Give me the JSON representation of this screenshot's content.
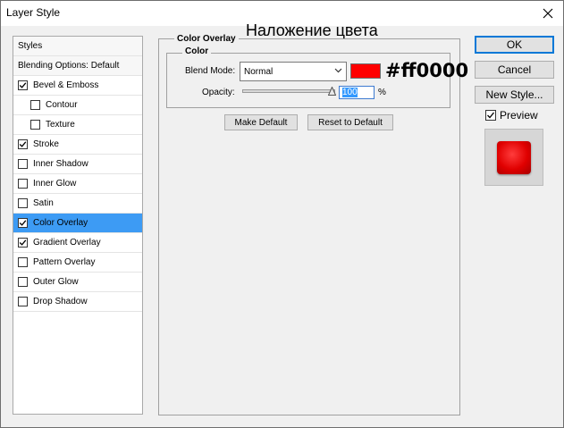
{
  "window": {
    "title": "Layer Style"
  },
  "annotation": {
    "title": "Наложение цвета",
    "hex": "#ff0000"
  },
  "sidebar": {
    "header": "Styles",
    "items": [
      {
        "label": "Blending Options: Default",
        "checkbox": false,
        "checked": false,
        "selected": false,
        "indent": false
      },
      {
        "label": "Bevel & Emboss",
        "checkbox": true,
        "checked": true,
        "selected": false,
        "indent": false
      },
      {
        "label": "Contour",
        "checkbox": true,
        "checked": false,
        "selected": false,
        "indent": true
      },
      {
        "label": "Texture",
        "checkbox": true,
        "checked": false,
        "selected": false,
        "indent": true
      },
      {
        "label": "Stroke",
        "checkbox": true,
        "checked": true,
        "selected": false,
        "indent": false
      },
      {
        "label": "Inner Shadow",
        "checkbox": true,
        "checked": false,
        "selected": false,
        "indent": false
      },
      {
        "label": "Inner Glow",
        "checkbox": true,
        "checked": false,
        "selected": false,
        "indent": false
      },
      {
        "label": "Satin",
        "checkbox": true,
        "checked": false,
        "selected": false,
        "indent": false
      },
      {
        "label": "Color Overlay",
        "checkbox": true,
        "checked": true,
        "selected": true,
        "indent": false
      },
      {
        "label": "Gradient Overlay",
        "checkbox": true,
        "checked": true,
        "selected": false,
        "indent": false
      },
      {
        "label": "Pattern Overlay",
        "checkbox": true,
        "checked": false,
        "selected": false,
        "indent": false
      },
      {
        "label": "Outer Glow",
        "checkbox": true,
        "checked": false,
        "selected": false,
        "indent": false
      },
      {
        "label": "Drop Shadow",
        "checkbox": true,
        "checked": false,
        "selected": false,
        "indent": false
      }
    ]
  },
  "panel": {
    "section_title": "Color Overlay",
    "group_title": "Color",
    "blend_mode_label": "Blend Mode:",
    "blend_mode_value": "Normal",
    "overlay_color": "#ff0000",
    "opacity_label": "Opacity:",
    "opacity_value": "100",
    "opacity_unit": "%",
    "make_default_label": "Make Default",
    "reset_label": "Reset to Default"
  },
  "actions": {
    "ok_label": "OK",
    "cancel_label": "Cancel",
    "new_style_label": "New Style...",
    "preview_label": "Preview",
    "preview_checked": true
  },
  "colors": {
    "selection": "#3d9bf4",
    "preview_red": "#e00000"
  },
  "icons": {
    "close": "close-icon",
    "dropdown": "chevron-down-icon",
    "check": "checkmark-icon",
    "slider": "slider-thumb-icon"
  }
}
